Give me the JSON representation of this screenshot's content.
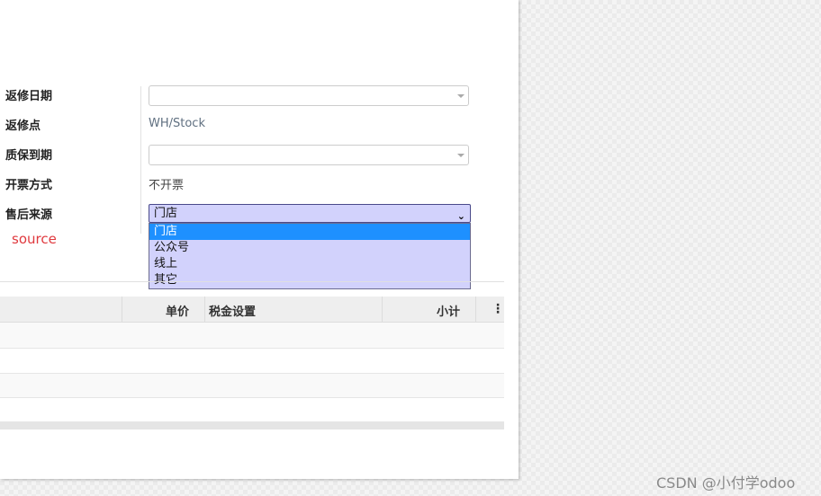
{
  "form": {
    "repair_date_label": "返修日期",
    "repair_point_label": "返修点",
    "repair_point_value": "WH/Stock",
    "warranty_date_label": "质保到期",
    "invoice_method_label": "开票方式",
    "invoice_method_value": "不开票",
    "source_label": "售后来源",
    "source_selected": "门店",
    "source_options": [
      "门店",
      "公众号",
      "线上",
      "其它"
    ]
  },
  "annotation": {
    "text": "source",
    "color": "#e0393e"
  },
  "table": {
    "headers": {
      "unit_price": "单价",
      "tax_settings": "税金设置",
      "subtotal": "小计"
    }
  },
  "watermark": "CSDN @小付学odoo",
  "colors": {
    "dropdown_bg": "#d2d2fc",
    "highlight": "#1e90ff"
  },
  "icons": {
    "select_chevron": "chevron-down-icon",
    "column_options": "kebab-icon"
  }
}
